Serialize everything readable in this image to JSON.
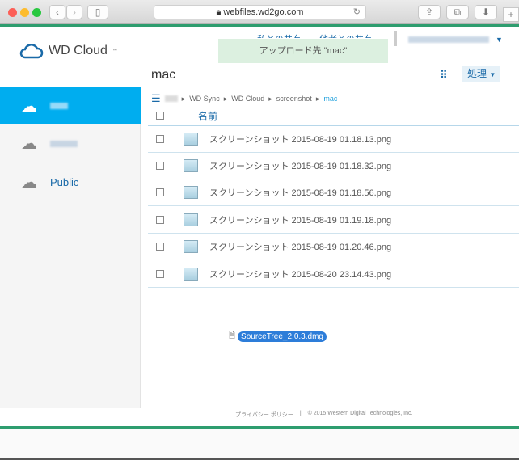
{
  "browser": {
    "url": "webfiles.wd2go.com",
    "back": "‹",
    "forward": "›",
    "new_tab": "+"
  },
  "header": {
    "logo": "WD Cloud",
    "logo_tm": "™",
    "nav": [
      "私との共有",
      "他者との共有"
    ],
    "toast": "アップロード先 \"mac\"",
    "folder_title": "mac",
    "action_button": "処理"
  },
  "sidebar": {
    "items": [
      {
        "label": "",
        "active": true
      },
      {
        "label": ""
      },
      {
        "label": "Public"
      }
    ]
  },
  "breadcrumb": [
    "WD Sync",
    "WD Cloud",
    "screenshot",
    "mac"
  ],
  "table": {
    "header": "名前",
    "files": [
      "スクリーンショット 2015-08-19 01.18.13.png",
      "スクリーンショット 2015-08-19 01.18.32.png",
      "スクリーンショット 2015-08-19 01.18.56.png",
      "スクリーンショット 2015-08-19 01.19.18.png",
      "スクリーンショット 2015-08-19 01.20.46.png",
      "スクリーンショット 2015-08-20 23.14.43.png"
    ]
  },
  "drag_file": "SourceTree_2.0.3.dmg",
  "footer": {
    "privacy": "プライバシー ポリシー",
    "sep": "|",
    "copyright": "© 2015 Western Digital Technologies, Inc."
  },
  "colors": {
    "green": "#2e9d6f",
    "accent": "#00adef"
  }
}
